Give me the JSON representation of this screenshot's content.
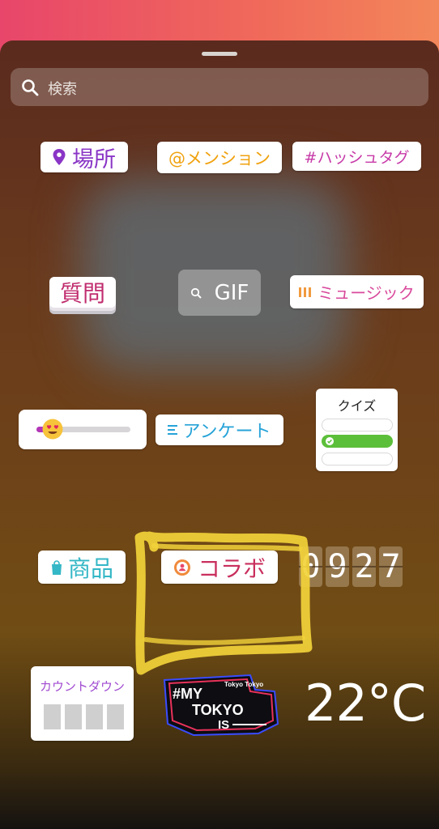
{
  "search": {
    "placeholder": "検索"
  },
  "stickers": {
    "location": "場所",
    "mention": "@メンション",
    "hashtag": "#ハッシュタグ",
    "question": "質問",
    "gif": "GIF",
    "music": "ミュージック",
    "poll": "アンケート",
    "quiz": "クイズ",
    "product": "商品",
    "collab": "コラボ",
    "time_digits": [
      "0",
      "9",
      "2",
      "7"
    ],
    "countdown": "カウントダウン",
    "tokyo_lines": [
      "#MY",
      "TOKYO",
      "IS"
    ],
    "tokyo_small": "Tokyo Tokyo",
    "temperature": "22°C"
  },
  "colors": {
    "header_gradient": [
      "#e8466a",
      "#f3875a"
    ],
    "highlight": "#f2d23a",
    "location": "#8a35c6",
    "mention": "#f0a20f",
    "hashtag": "#c73aa8",
    "question": "#c02c6e",
    "poll": "#27a3d8",
    "product": "#34b7c6",
    "collab": "#c92f5e"
  },
  "icons": {
    "search": "search-icon",
    "location": "location-pin-icon",
    "gif": "search-icon",
    "music": "audio-bars-icon",
    "product": "shopping-bag-icon",
    "collab": "collab-icon"
  }
}
